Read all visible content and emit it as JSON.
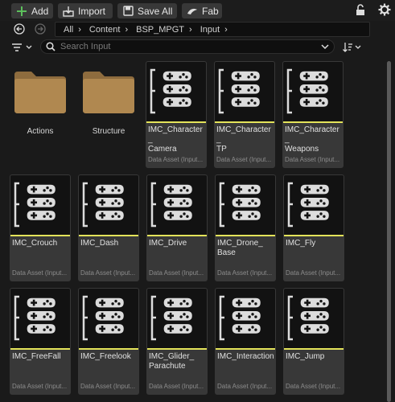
{
  "toolbar": {
    "add_label": "Add",
    "import_label": "Import",
    "save_all_label": "Save All",
    "fab_label": "Fab"
  },
  "breadcrumbs": [
    "All",
    "Content",
    "BSP_MPGT",
    "Input"
  ],
  "search": {
    "placeholder": "Search Input"
  },
  "folders": [
    "Actions",
    "Structure"
  ],
  "assets": [
    {
      "name": "IMC_Character_\nCamera",
      "type": "Data Asset (Input..."
    },
    {
      "name": "IMC_Character_\nTP",
      "type": "Data Asset (Input..."
    },
    {
      "name": "IMC_Character_\nWeapons",
      "type": "Data Asset (Input..."
    },
    {
      "name": "IMC_Crouch",
      "type": "Data Asset (Input..."
    },
    {
      "name": "IMC_Dash",
      "type": "Data Asset (Input..."
    },
    {
      "name": "IMC_Drive",
      "type": "Data Asset (Input..."
    },
    {
      "name": "IMC_Drone_\nBase",
      "type": "Data Asset (Input..."
    },
    {
      "name": "IMC_Fly",
      "type": "Data Asset (Input..."
    },
    {
      "name": "IMC_FreeFall",
      "type": "Data Asset (Input..."
    },
    {
      "name": "IMC_Freelook",
      "type": "Data Asset (Input..."
    },
    {
      "name": "IMC_Glider_\nParachute",
      "type": "Data Asset (Input..."
    },
    {
      "name": "IMC_Interaction",
      "type": "Data Asset (Input..."
    },
    {
      "name": "IMC_Jump",
      "type": "Data Asset (Input..."
    }
  ],
  "colors": {
    "accent_line": "#e3e35a",
    "add_icon": "#5cc05c",
    "folder": "#b08850"
  },
  "icons": [
    "plus-icon",
    "import-icon",
    "save-icon",
    "fab-icon",
    "lock-icon",
    "settings-gear-icon",
    "back-arrow-icon",
    "forward-arrow-icon",
    "filter-icon",
    "search-icon",
    "sort-icon",
    "folder-icon",
    "input-mapping-context-icon"
  ]
}
